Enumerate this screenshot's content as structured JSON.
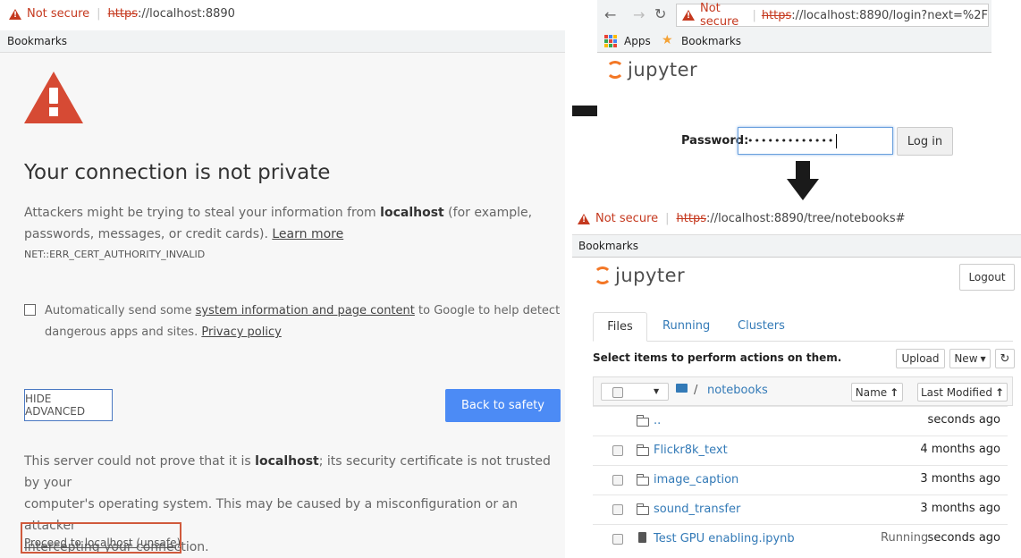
{
  "left": {
    "not_secure": "Not secure",
    "url_scheme": "https",
    "url_rest": "://localhost:8890",
    "bookmarks": "Bookmarks",
    "heading": "Your connection is not private",
    "desc_1": "Attackers might be trying to steal your information from ",
    "desc_host": "localhost",
    "desc_2": " (for example,",
    "desc_3": "passwords, messages, or credit cards). ",
    "learn_more": "Learn more",
    "error_code": "NET::ERR_CERT_AUTHORITY_INVALID",
    "checkbox_1": "Automatically send some ",
    "checkbox_link": "system information and page content",
    "checkbox_2": " to Google to help detect",
    "checkbox_3": "dangerous apps and sites. ",
    "privacy_link": "Privacy policy",
    "hide_advanced": "HIDE ADVANCED",
    "back_to_safety": "Back to safety",
    "server_1": "This server could not prove that it is ",
    "server_host": "localhost",
    "server_2": "; its security certificate is not trusted by your",
    "server_3": "computer's operating system. This may be caused by a misconfiguration or an attacker",
    "server_4": "intercepting your connection.",
    "proceed": "Proceed to localhost (unsafe)"
  },
  "login": {
    "not_secure": "Not secure",
    "url_scheme": "https",
    "url_rest": "://localhost:8890/login?next=%2F",
    "apps": "Apps",
    "bookmarks": "Bookmarks",
    "logo": "jupyter",
    "password_label": "Password:",
    "password_value": "•••••••••••••",
    "login_button": "Log in"
  },
  "tree": {
    "not_secure": "Not secure",
    "url_scheme": "https",
    "url_rest": "://localhost:8890/tree/notebooks#",
    "bookmarks": "Bookmarks",
    "logo": "jupyter",
    "logout": "Logout",
    "tabs": [
      "Files",
      "Running",
      "Clusters"
    ],
    "select_text": "Select items to perform actions on them.",
    "upload": "Upload",
    "new": "New",
    "breadcrumb_sep": "/",
    "breadcrumb_dir": "notebooks",
    "sort_name": "Name",
    "sort_modified": "Last Modified",
    "rows": [
      {
        "name": "..",
        "status": "",
        "modified": "seconds ago"
      },
      {
        "name": "Flickr8k_text",
        "status": "",
        "modified": "4 months ago"
      },
      {
        "name": "image_caption",
        "status": "",
        "modified": "3 months ago"
      },
      {
        "name": "sound_transfer",
        "status": "",
        "modified": "3 months ago"
      },
      {
        "name": "Test GPU enabling.ipynb",
        "status": "Running",
        "modified": "seconds ago"
      }
    ]
  },
  "colors": {
    "warning_red": "#c5391f",
    "safety_blue": "#4285f4",
    "proceed_box": "#d05a3c",
    "jupyter_orange": "#f37726",
    "link_blue": "#337ab7"
  }
}
